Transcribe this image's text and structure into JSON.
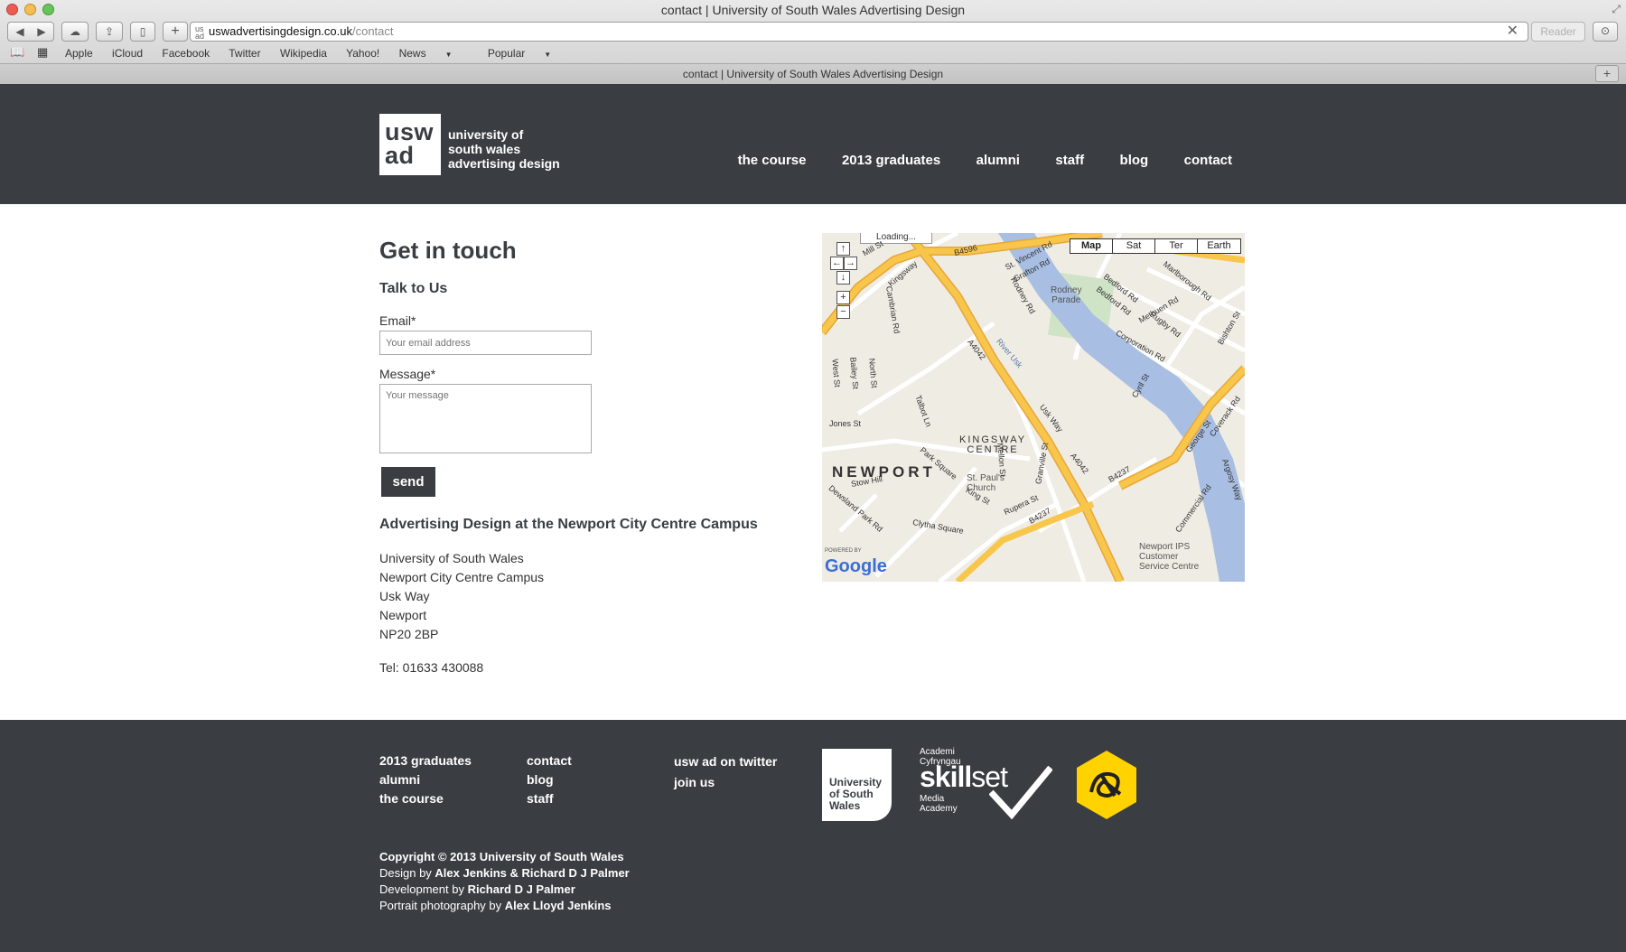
{
  "browser": {
    "window_title": "contact | University of South Wales Advertising Design",
    "url_domain": "uswadvertisingdesign.co.uk",
    "url_path": "/contact",
    "reader_label": "Reader",
    "bookmarks": [
      "Apple",
      "iCloud",
      "Facebook",
      "Twitter",
      "Wikipedia",
      "Yahoo!",
      "News",
      "Popular"
    ],
    "tab_title": "contact | University of South Wales Advertising Design"
  },
  "header": {
    "logo_mark_line1": "usw",
    "logo_mark_line2": "ad",
    "logo_text_line1": "university of",
    "logo_text_line2": "south wales",
    "logo_text_line3": "advertising design",
    "nav": [
      "the course",
      "2013 graduates",
      "alumni",
      "staff",
      "blog",
      "contact"
    ]
  },
  "contact": {
    "heading": "Get in touch",
    "subheading": "Talk to Us",
    "email_label": "Email*",
    "email_placeholder": "Your email address",
    "message_label": "Message*",
    "message_placeholder": "Your message",
    "send_label": "send",
    "campus_heading": "Advertising Design at the Newport City Centre Campus",
    "address": [
      "University of South Wales",
      "Newport City Centre Campus",
      "Usk Way",
      "Newport",
      "NP20 2BP"
    ],
    "telephone": "Tel: 01633 430088"
  },
  "map": {
    "types": [
      "Map",
      "Sat",
      "Ter",
      "Earth"
    ],
    "active_type": "Map",
    "loading_text": "Loading...",
    "powered_by": "POWERED BY",
    "google": "Google",
    "city_label": "NEWPORT",
    "area_line1": "KINGSWAY",
    "area_line2": "CENTRE",
    "rodney_line1": "Rodney",
    "rodney_line2": "Parade",
    "church_line1": "St. Paul's",
    "church_line2": "Church",
    "ips_line1": "Newport IPS",
    "ips_line2": "Customer",
    "ips_line3": "Service Centre",
    "road_labels": [
      "B4596",
      "A4042",
      "Usk Way",
      "A4042",
      "B4237",
      "B4237",
      "River Usk",
      "George St",
      "St. Vincent Rd",
      "Grafton Rd",
      "Rodney Rd",
      "Cambrian Rd",
      "Jones St",
      "Stow Hill",
      "Park Square",
      "King St",
      "Clytha Square",
      "Mellon St",
      "Granville St",
      "Rupera St",
      "Corporation Rd",
      "Rugby Rd",
      "Marlborough Rd",
      "Bedford Rd",
      "Methuen Rd",
      "Cyril St",
      "Bishton St",
      "Coverack Rd",
      "Argosy Way",
      "Bailey St",
      "North St",
      "West St",
      "Talbot Ln",
      "Dewsland Park Rd",
      "Mill St",
      "Commercial Rd",
      "Kingsway",
      "Bedford Rd"
    ]
  },
  "footer": {
    "col1": [
      "2013 graduates",
      "alumni",
      "the course"
    ],
    "col2": [
      "contact",
      "blog",
      "staff"
    ],
    "col3": [
      "usw ad on twitter",
      "join us"
    ],
    "usw_logo_line1": "University",
    "usw_logo_line2": "of South",
    "usw_logo_line3": "Wales",
    "skillset_small_line1": "Academi",
    "skillset_small_line2": "Cyfryngau",
    "skillset_bold": "skill",
    "skillset_light": "set",
    "skillset_media_line1": "Media",
    "skillset_media_line2": "Academy",
    "copyright": "Copyright © 2013 University of South Wales",
    "design_prefix": "Design by ",
    "design_names": "Alex Jenkins & Richard D J Palmer",
    "dev_prefix": "Development by ",
    "dev_names": "Richard D J Palmer",
    "photo_prefix": "Portrait photography by ",
    "photo_names": "Alex Lloyd Jenkins"
  },
  "colors": {
    "dark": "#3a3d42",
    "river": "#a8bee2",
    "major_road": "#f7c64a",
    "dad_yellow": "#ffd200"
  }
}
